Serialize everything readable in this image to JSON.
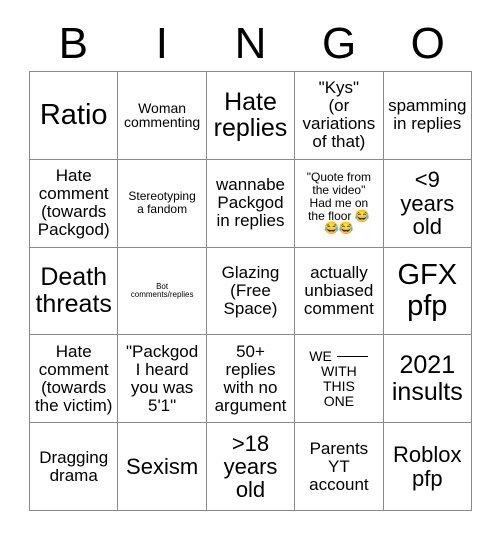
{
  "header": {
    "letters": [
      "B",
      "I",
      "N",
      "G",
      "O"
    ]
  },
  "grid": {
    "rows": 5,
    "columns": 5,
    "free_space_index": 12,
    "border_color": "#8a8a8a",
    "background": "#ffffff",
    "text_color": "#000000",
    "cells": [
      {
        "text": "Ratio",
        "size": "fs-xxl"
      },
      {
        "text": "Woman\ncommenting",
        "size": "fs-sm"
      },
      {
        "text": "Hate\nreplies",
        "size": "fs-xl"
      },
      {
        "text": "\"Kys\"\n(or\nvariations\nof that)",
        "size": "fs-md"
      },
      {
        "text": "spamming\nin replies",
        "size": "fs-md"
      },
      {
        "text": "Hate\ncomment\n(towards\nPackgod)",
        "size": "fs-md"
      },
      {
        "text": "Stereotyping\na fandom",
        "size": "fs-xs"
      },
      {
        "text": "wannabe\nPackgod\nin replies",
        "size": "fs-md"
      },
      {
        "text": "\"Quote from\nthe video\"\nHad me on\nthe floor 😂\n😂😂",
        "size": "fs-xs"
      },
      {
        "text": "<9\nyears\nold",
        "size": "fs-lg"
      },
      {
        "text": "Death\nthreats",
        "size": "fs-xl"
      },
      {
        "text": "Bot\ncomments/replies",
        "size": "fs-xxs"
      },
      {
        "text": "Glazing\n(Free\nSpace)",
        "size": "fs-md"
      },
      {
        "text": "actually\nunbiased\ncomment",
        "size": "fs-md"
      },
      {
        "text": "GFX\npfp",
        "size": "fs-xxl"
      },
      {
        "text": "Hate\ncomment\n(towards\nthe victim)",
        "size": "fs-md"
      },
      {
        "text": "\"Packgod\nI heard\nyou was\n5'1\"",
        "size": "fs-md"
      },
      {
        "text": "50+\nreplies\nwith no\nargument",
        "size": "fs-md"
      },
      {
        "text": "WE ___\nWITH\nTHIS\nONE",
        "size": "fs-sm",
        "has_blank": true
      },
      {
        "text": "2021\ninsults",
        "size": "fs-xl"
      },
      {
        "text": "Dragging\ndrama",
        "size": "fs-md"
      },
      {
        "text": "Sexism",
        "size": "fs-lg"
      },
      {
        "text": ">18\nyears\nold",
        "size": "fs-lg"
      },
      {
        "text": "Parents\nYT\naccount",
        "size": "fs-md"
      },
      {
        "text": "Roblox\npfp",
        "size": "fs-lg"
      }
    ]
  }
}
